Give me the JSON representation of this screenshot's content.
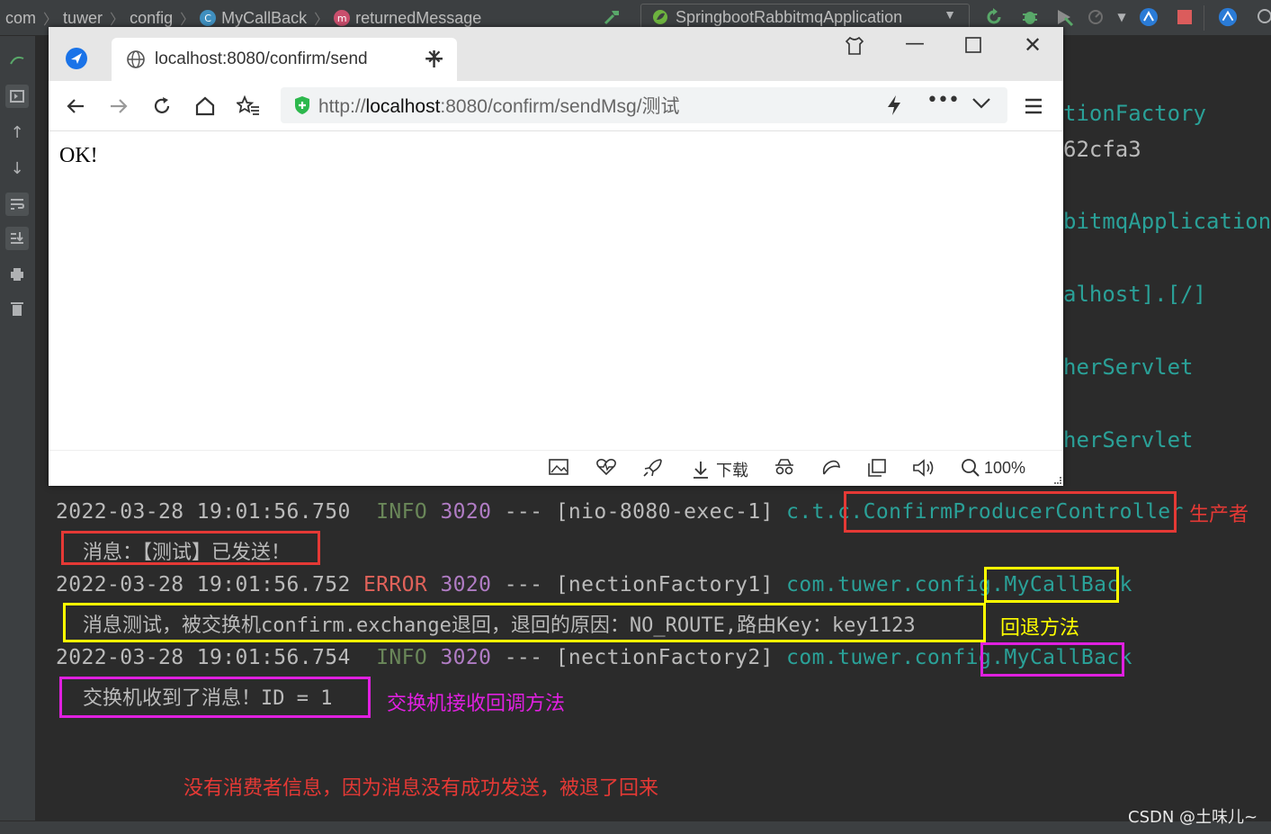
{
  "ide": {
    "breadcrumbs": [
      "com",
      "tuwer",
      "config",
      "MyCallBack",
      "returnedMessage"
    ],
    "run_config": "SpringbootRabbitmqApplication"
  },
  "background_code": [
    "tionFactory",
    "62cfa3",
    "bitmqApplication",
    "alhost].[/]",
    "herServlet",
    "herServlet"
  ],
  "browser": {
    "tab_title": "localhost:8080/confirm/send",
    "url_prefix": "http://",
    "url_host": "localhost",
    "url_rest": ":8080/confirm/sendMsg/测试",
    "page_text": "OK!",
    "status": {
      "download_label": "下载",
      "zoom": "100%"
    }
  },
  "console": {
    "line1": {
      "ts": "2022-03-28 19:01:56.750",
      "level": "INFO",
      "pid": "3020",
      "sep": "---",
      "thread": "[nio-8080-exec-1]",
      "pkg": "c.t.c.",
      "cls": "ConfirmProducerController"
    },
    "msg1": "消息：【测试】已发送！",
    "line2": {
      "ts": "2022-03-28 19:01:56.752",
      "level": "ERROR",
      "pid": "3020",
      "sep": "---",
      "thread": "[nectionFactory1]",
      "pkg": "com.tuwer.config.",
      "cls": "MyCallBack"
    },
    "msg2": "消息测试，被交换机confirm.exchange退回，退回的原因：NO_ROUTE,路由Key：key1123",
    "line3": {
      "ts": "2022-03-28 19:01:56.754",
      "level": "INFO",
      "pid": "3020",
      "sep": "---",
      "thread": "[nectionFactory2]",
      "pkg": "com.tuwer.config.",
      "cls": "MyCallBack"
    },
    "msg3": "交换机收到了消息！ID = 1"
  },
  "annotations": {
    "producer": "生产者",
    "return_method": "回退方法",
    "confirm_method": "交换机接收回调方法",
    "note": "没有消费者信息，因为消息没有成功发送，被退了回来",
    "watermark": "CSDN @土味儿~"
  },
  "colors": {
    "red": "#e53935",
    "yellow": "#ffff00",
    "magenta": "#e020e0"
  }
}
